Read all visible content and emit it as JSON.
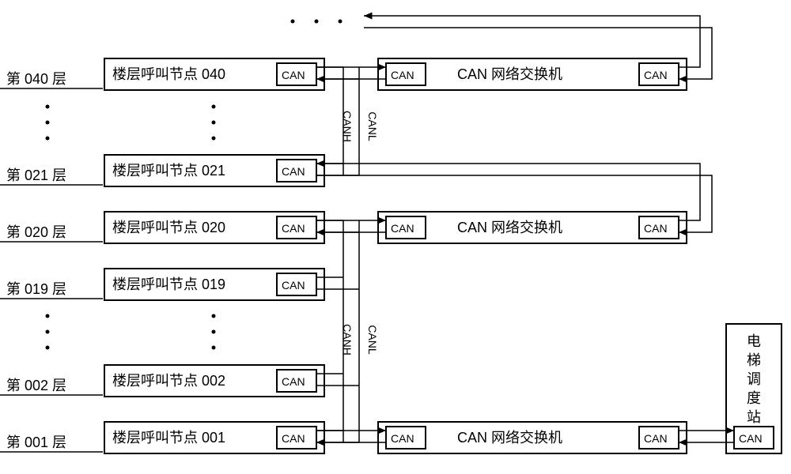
{
  "floors": {
    "f040": {
      "label": "第 040 层",
      "node_label": "楼层呼叫节点 040",
      "can": "CAN"
    },
    "f021": {
      "label": "第 021 层",
      "node_label": "楼层呼叫节点 021",
      "can": "CAN"
    },
    "f020": {
      "label": "第 020 层",
      "node_label": "楼层呼叫节点 020",
      "can": "CAN"
    },
    "f019": {
      "label": "第 019 层",
      "node_label": "楼层呼叫节点 019",
      "can": "CAN"
    },
    "f002": {
      "label": "第 002 层",
      "node_label": "楼层呼叫节点 002",
      "can": "CAN"
    },
    "f001": {
      "label": "第 001 层",
      "node_label": "楼层呼叫节点 001",
      "can": "CAN"
    }
  },
  "switch": {
    "label": "CAN 网络交换机",
    "can": "CAN"
  },
  "dispatch": {
    "line1": "电",
    "line2": "梯",
    "line3": "调",
    "line4": "度",
    "line5": "站",
    "can": "CAN"
  },
  "bus": {
    "canh": "CANH",
    "canl": "CANL"
  }
}
